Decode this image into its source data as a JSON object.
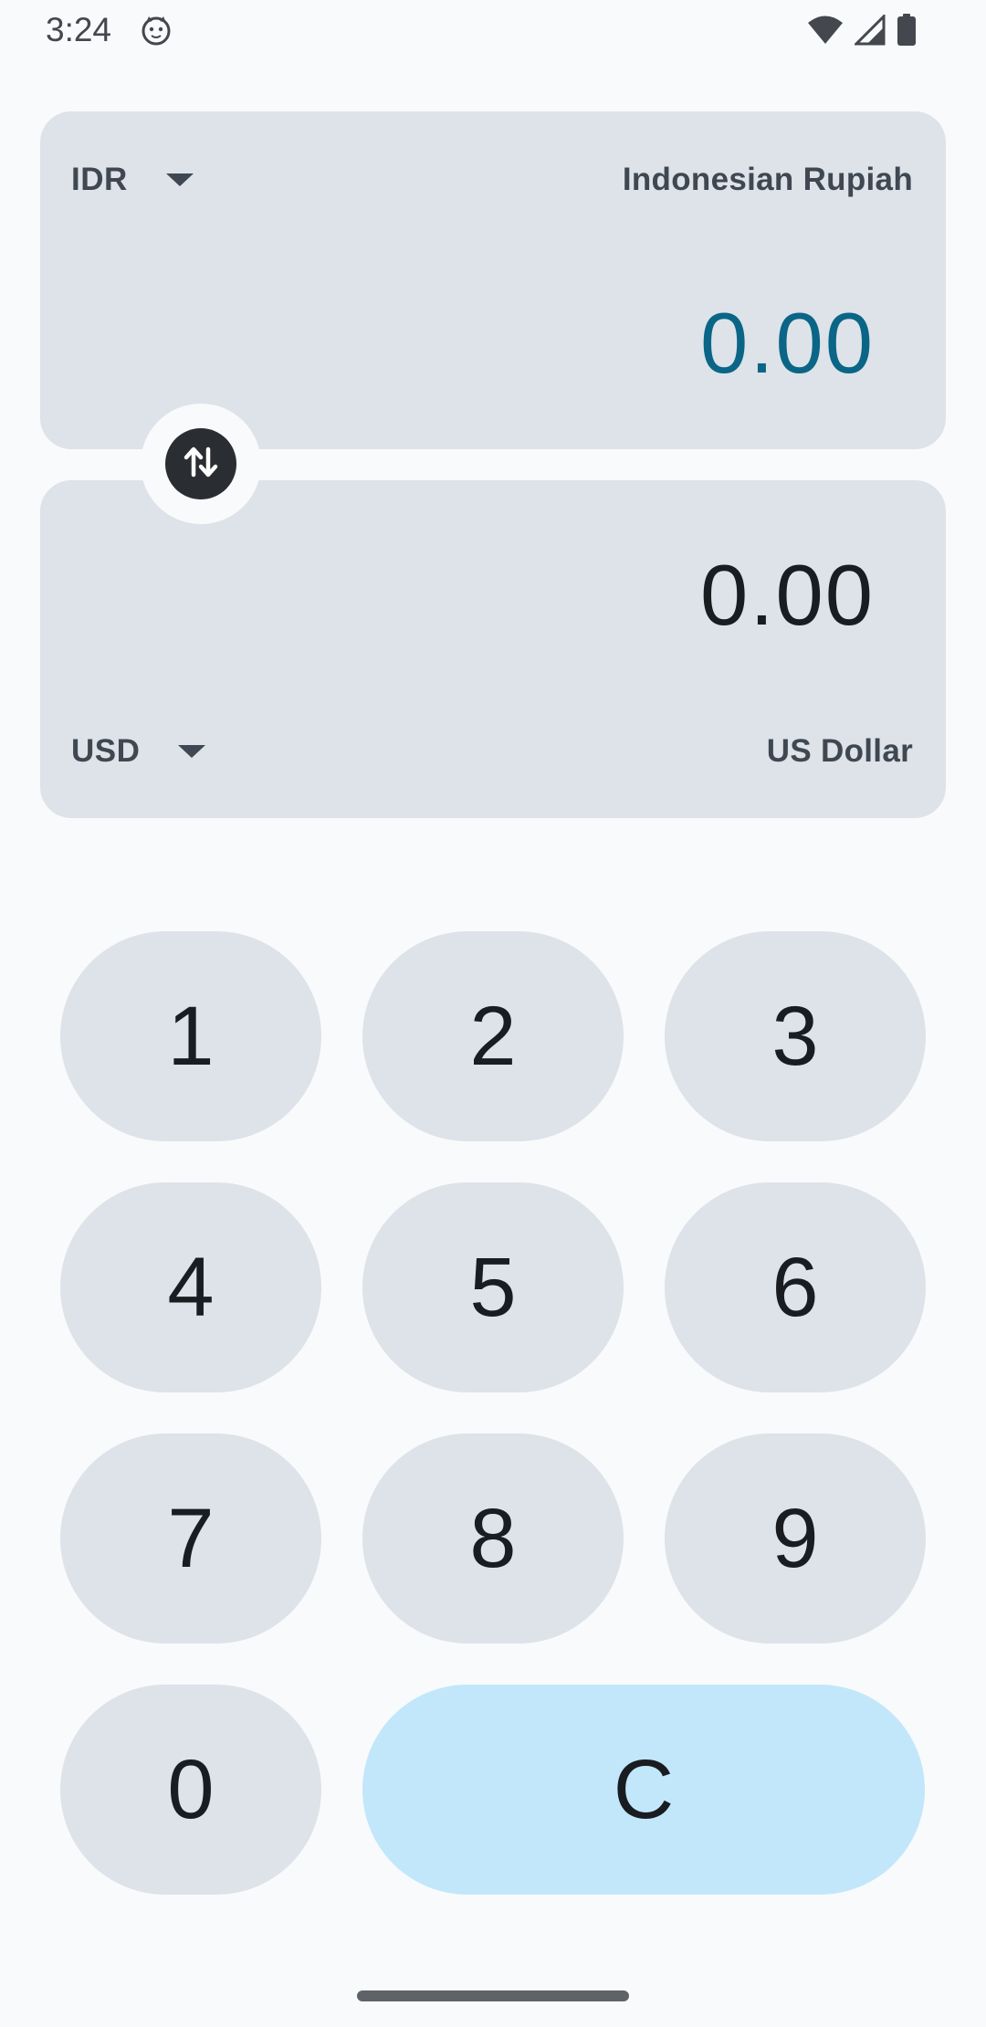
{
  "status_bar": {
    "time": "3:24",
    "app_icon": "cat-face-icon",
    "icons": [
      "wifi-icon",
      "cellular-signal-icon",
      "battery-icon"
    ]
  },
  "converter": {
    "from": {
      "code": "IDR",
      "name": "Indonesian Rupiah",
      "amount": "0.00"
    },
    "to": {
      "code": "USD",
      "name": "US Dollar",
      "amount": "0.00"
    },
    "swap_icon": "swap-vertical-icon"
  },
  "keypad": {
    "keys": [
      "1",
      "2",
      "3",
      "4",
      "5",
      "6",
      "7",
      "8",
      "9",
      "0"
    ],
    "clear": "C"
  },
  "colors": {
    "background": "#F9FAFC",
    "card": "#DDE3E8",
    "active_amount": "#0A6587",
    "clear_key": "#C2E7FB",
    "swap_button": "#2A2D31"
  }
}
